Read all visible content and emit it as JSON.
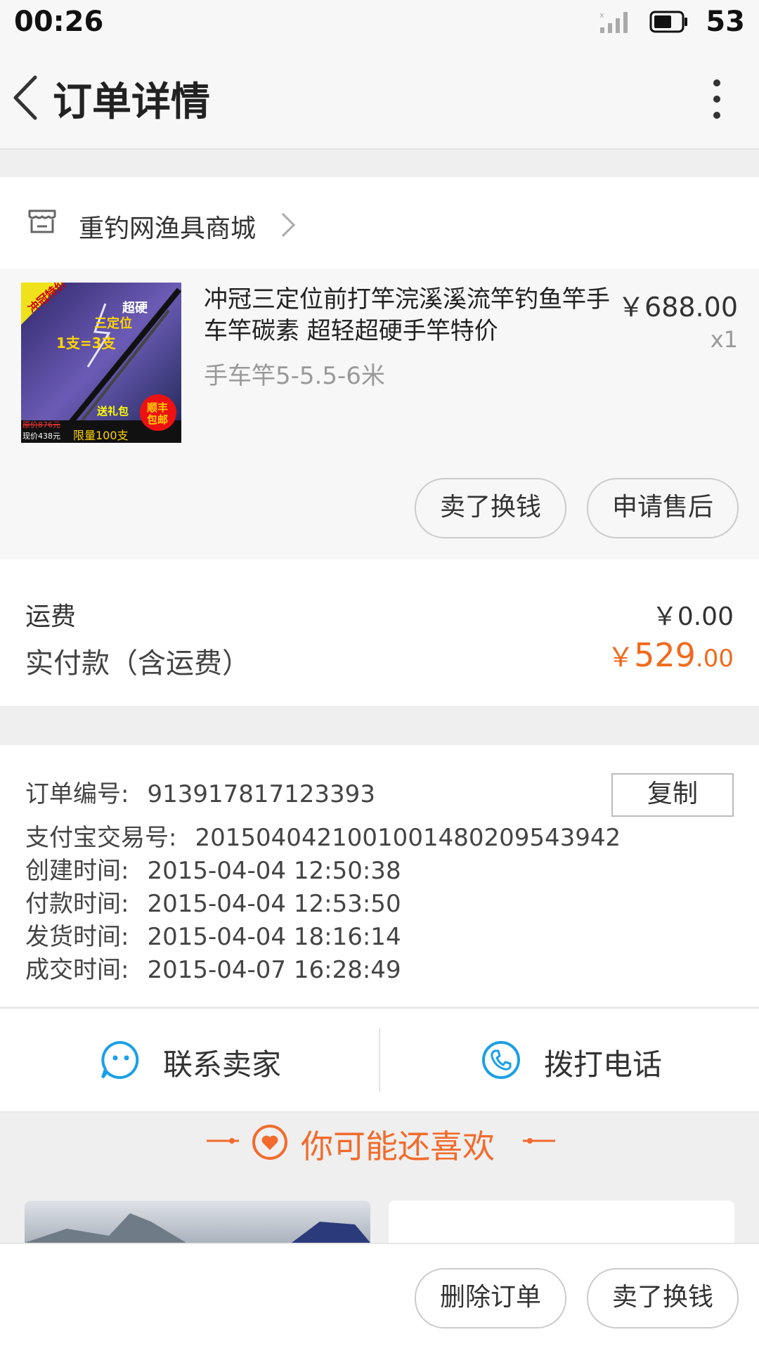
{
  "status_bar": {
    "time": "00:26",
    "battery": "53"
  },
  "header": {
    "title": "订单详情"
  },
  "store": {
    "name": "重钓网渔具商城"
  },
  "product": {
    "title": "冲冠三定位前打竿浣溪溪流竿钓鱼竿手车竿碳素 超轻超硬手竿特价",
    "spec": "手车竿5-5.5-6米",
    "price": "￥688.00",
    "qty": "x1",
    "image_texts": {
      "badge": "冲冠特价",
      "hard": "超硬",
      "three_pos": "三定位",
      "equation": "1支=3支",
      "orig_price": "原价876元",
      "now_price": "现价438元",
      "limit": "限量100支",
      "shipping": "顺丰包邮",
      "gift": "送礼包"
    },
    "buttons": {
      "sell": "卖了换钱",
      "aftersale": "申请售后"
    }
  },
  "totals": {
    "fee_label": "运费",
    "fee_value": "￥0.00",
    "paid_label": "实付款（含运费）",
    "paid_currency": "￥",
    "paid_int": "529",
    "paid_dec": ".00",
    "accent_color": "#f06a1d"
  },
  "order_info": {
    "copy_label": "复制",
    "rows": [
      {
        "label": "订单编号:",
        "value": "913917817123393"
      },
      {
        "label": "支付宝交易号:",
        "value": "2015040421001001480209543942"
      },
      {
        "label": "创建时间:",
        "value": "2015-04-04 12:50:38"
      },
      {
        "label": "付款时间:",
        "value": "2015-04-04 12:53:50"
      },
      {
        "label": "发货时间:",
        "value": "2015-04-04 18:16:14"
      },
      {
        "label": "成交时间:",
        "value": "2015-04-07 16:28:49"
      }
    ]
  },
  "contact": {
    "seller": "联系卖家",
    "phone": "拨打电话"
  },
  "recommend": {
    "title": "你可能还喜欢"
  },
  "bottom": {
    "delete": "删除订单",
    "sell": "卖了换钱"
  }
}
